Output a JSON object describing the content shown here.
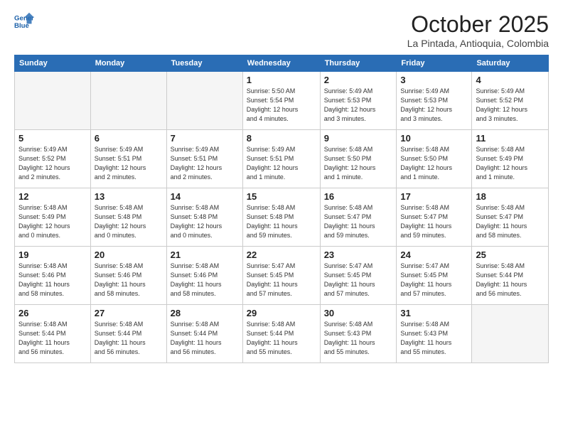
{
  "header": {
    "logo_line1": "General",
    "logo_line2": "Blue",
    "title": "October 2025",
    "subtitle": "La Pintada, Antioquia, Colombia"
  },
  "weekdays": [
    "Sunday",
    "Monday",
    "Tuesday",
    "Wednesday",
    "Thursday",
    "Friday",
    "Saturday"
  ],
  "weeks": [
    [
      {
        "day": "",
        "info": ""
      },
      {
        "day": "",
        "info": ""
      },
      {
        "day": "",
        "info": ""
      },
      {
        "day": "1",
        "info": "Sunrise: 5:50 AM\nSunset: 5:54 PM\nDaylight: 12 hours\nand 4 minutes."
      },
      {
        "day": "2",
        "info": "Sunrise: 5:49 AM\nSunset: 5:53 PM\nDaylight: 12 hours\nand 3 minutes."
      },
      {
        "day": "3",
        "info": "Sunrise: 5:49 AM\nSunset: 5:53 PM\nDaylight: 12 hours\nand 3 minutes."
      },
      {
        "day": "4",
        "info": "Sunrise: 5:49 AM\nSunset: 5:52 PM\nDaylight: 12 hours\nand 3 minutes."
      }
    ],
    [
      {
        "day": "5",
        "info": "Sunrise: 5:49 AM\nSunset: 5:52 PM\nDaylight: 12 hours\nand 2 minutes."
      },
      {
        "day": "6",
        "info": "Sunrise: 5:49 AM\nSunset: 5:51 PM\nDaylight: 12 hours\nand 2 minutes."
      },
      {
        "day": "7",
        "info": "Sunrise: 5:49 AM\nSunset: 5:51 PM\nDaylight: 12 hours\nand 2 minutes."
      },
      {
        "day": "8",
        "info": "Sunrise: 5:49 AM\nSunset: 5:51 PM\nDaylight: 12 hours\nand 1 minute."
      },
      {
        "day": "9",
        "info": "Sunrise: 5:48 AM\nSunset: 5:50 PM\nDaylight: 12 hours\nand 1 minute."
      },
      {
        "day": "10",
        "info": "Sunrise: 5:48 AM\nSunset: 5:50 PM\nDaylight: 12 hours\nand 1 minute."
      },
      {
        "day": "11",
        "info": "Sunrise: 5:48 AM\nSunset: 5:49 PM\nDaylight: 12 hours\nand 1 minute."
      }
    ],
    [
      {
        "day": "12",
        "info": "Sunrise: 5:48 AM\nSunset: 5:49 PM\nDaylight: 12 hours\nand 0 minutes."
      },
      {
        "day": "13",
        "info": "Sunrise: 5:48 AM\nSunset: 5:48 PM\nDaylight: 12 hours\nand 0 minutes."
      },
      {
        "day": "14",
        "info": "Sunrise: 5:48 AM\nSunset: 5:48 PM\nDaylight: 12 hours\nand 0 minutes."
      },
      {
        "day": "15",
        "info": "Sunrise: 5:48 AM\nSunset: 5:48 PM\nDaylight: 11 hours\nand 59 minutes."
      },
      {
        "day": "16",
        "info": "Sunrise: 5:48 AM\nSunset: 5:47 PM\nDaylight: 11 hours\nand 59 minutes."
      },
      {
        "day": "17",
        "info": "Sunrise: 5:48 AM\nSunset: 5:47 PM\nDaylight: 11 hours\nand 59 minutes."
      },
      {
        "day": "18",
        "info": "Sunrise: 5:48 AM\nSunset: 5:47 PM\nDaylight: 11 hours\nand 58 minutes."
      }
    ],
    [
      {
        "day": "19",
        "info": "Sunrise: 5:48 AM\nSunset: 5:46 PM\nDaylight: 11 hours\nand 58 minutes."
      },
      {
        "day": "20",
        "info": "Sunrise: 5:48 AM\nSunset: 5:46 PM\nDaylight: 11 hours\nand 58 minutes."
      },
      {
        "day": "21",
        "info": "Sunrise: 5:48 AM\nSunset: 5:46 PM\nDaylight: 11 hours\nand 58 minutes."
      },
      {
        "day": "22",
        "info": "Sunrise: 5:47 AM\nSunset: 5:45 PM\nDaylight: 11 hours\nand 57 minutes."
      },
      {
        "day": "23",
        "info": "Sunrise: 5:47 AM\nSunset: 5:45 PM\nDaylight: 11 hours\nand 57 minutes."
      },
      {
        "day": "24",
        "info": "Sunrise: 5:47 AM\nSunset: 5:45 PM\nDaylight: 11 hours\nand 57 minutes."
      },
      {
        "day": "25",
        "info": "Sunrise: 5:48 AM\nSunset: 5:44 PM\nDaylight: 11 hours\nand 56 minutes."
      }
    ],
    [
      {
        "day": "26",
        "info": "Sunrise: 5:48 AM\nSunset: 5:44 PM\nDaylight: 11 hours\nand 56 minutes."
      },
      {
        "day": "27",
        "info": "Sunrise: 5:48 AM\nSunset: 5:44 PM\nDaylight: 11 hours\nand 56 minutes."
      },
      {
        "day": "28",
        "info": "Sunrise: 5:48 AM\nSunset: 5:44 PM\nDaylight: 11 hours\nand 56 minutes."
      },
      {
        "day": "29",
        "info": "Sunrise: 5:48 AM\nSunset: 5:44 PM\nDaylight: 11 hours\nand 55 minutes."
      },
      {
        "day": "30",
        "info": "Sunrise: 5:48 AM\nSunset: 5:43 PM\nDaylight: 11 hours\nand 55 minutes."
      },
      {
        "day": "31",
        "info": "Sunrise: 5:48 AM\nSunset: 5:43 PM\nDaylight: 11 hours\nand 55 minutes."
      },
      {
        "day": "",
        "info": ""
      }
    ]
  ]
}
